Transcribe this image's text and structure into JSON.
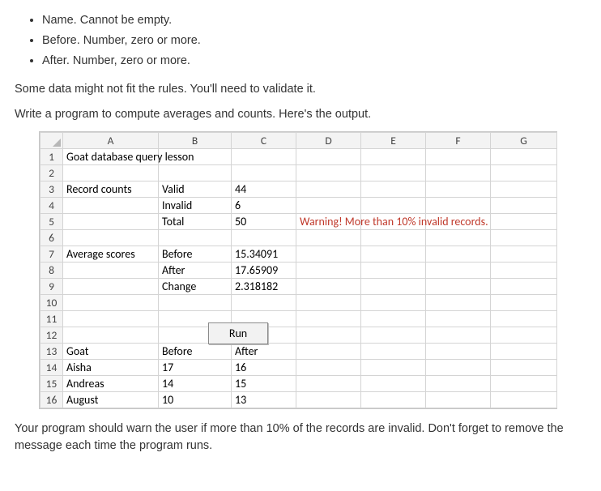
{
  "rules": [
    "Name. Cannot be empty.",
    "Before. Number, zero or more.",
    "After. Number, zero or more."
  ],
  "para1": "Some data might not fit the rules. You'll need to validate it.",
  "para2": "Write a program to compute averages and counts. Here's the output.",
  "sheet": {
    "cols": [
      "A",
      "B",
      "C",
      "D",
      "E",
      "F",
      "G"
    ],
    "rowcount": 16,
    "title": "Goat database query lesson",
    "record_counts_label": "Record counts",
    "valid_label": "Valid",
    "valid_val": "44",
    "invalid_label": "Invalid",
    "invalid_val": "6",
    "total_label": "Total",
    "total_val": "50",
    "warning_text": "Warning! More than 10% invalid records.",
    "avg_label": "Average scores",
    "before_label": "Before",
    "before_val": "15.34091",
    "after_label": "After",
    "after_val": "17.65909",
    "change_label": "Change",
    "change_val": "2.318182",
    "run_label": "Run",
    "hdr_goat": "Goat",
    "hdr_before": "Before",
    "hdr_after": "After",
    "rows": [
      {
        "name": "Aisha",
        "before": "17",
        "after": "16"
      },
      {
        "name": "Andreas",
        "before": "14",
        "after": "15"
      },
      {
        "name": "August",
        "before": "10",
        "after": "13"
      }
    ]
  },
  "para3": "Your program should warn the user if more than 10% of the records are invalid. Don't forget to remove the message each time the program runs.",
  "chart_data": {
    "type": "table",
    "title": "Goat database query lesson",
    "record_counts": {
      "Valid": 44,
      "Invalid": 6,
      "Total": 50
    },
    "warning": "Warning! More than 10% invalid records.",
    "average_scores": {
      "Before": 15.34091,
      "After": 17.65909,
      "Change": 2.318182
    },
    "data_rows": {
      "columns": [
        "Goat",
        "Before",
        "After"
      ],
      "rows": [
        [
          "Aisha",
          17,
          16
        ],
        [
          "Andreas",
          14,
          15
        ],
        [
          "August",
          10,
          13
        ]
      ]
    }
  }
}
